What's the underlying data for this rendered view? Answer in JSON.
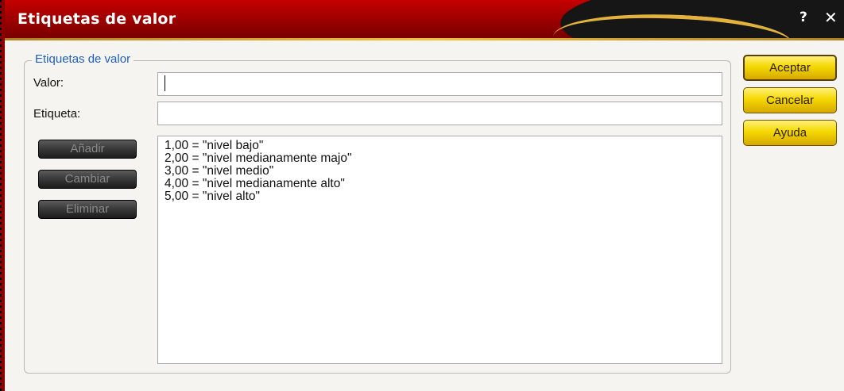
{
  "window": {
    "title": "Etiquetas de valor",
    "help_glyph": "?",
    "close_glyph": "✕"
  },
  "group": {
    "legend": "Etiquetas de valor",
    "valor_label": "Valor:",
    "valor_value": "",
    "etiqueta_label": "Etiqueta:",
    "etiqueta_value": ""
  },
  "actions": {
    "add": "Añadir",
    "change": "Cambiar",
    "remove": "Eliminar"
  },
  "labels_list": [
    "1,00 = \"nivel bajo\"",
    "2,00 = \"nivel medianamente majo\"",
    "3,00 = \"nivel medio\"",
    "4,00 = \"nivel medianamente alto\"",
    "5,00 = \"nivel alto\""
  ],
  "dialog_buttons": {
    "ok": "Aceptar",
    "cancel": "Cancelar",
    "help": "Ayuda"
  },
  "colors": {
    "titlebar": "#a10000",
    "accent_gold": "#f0c040",
    "legend_blue": "#1f5fc4",
    "dialog_button_yellow": "#f5d800"
  }
}
